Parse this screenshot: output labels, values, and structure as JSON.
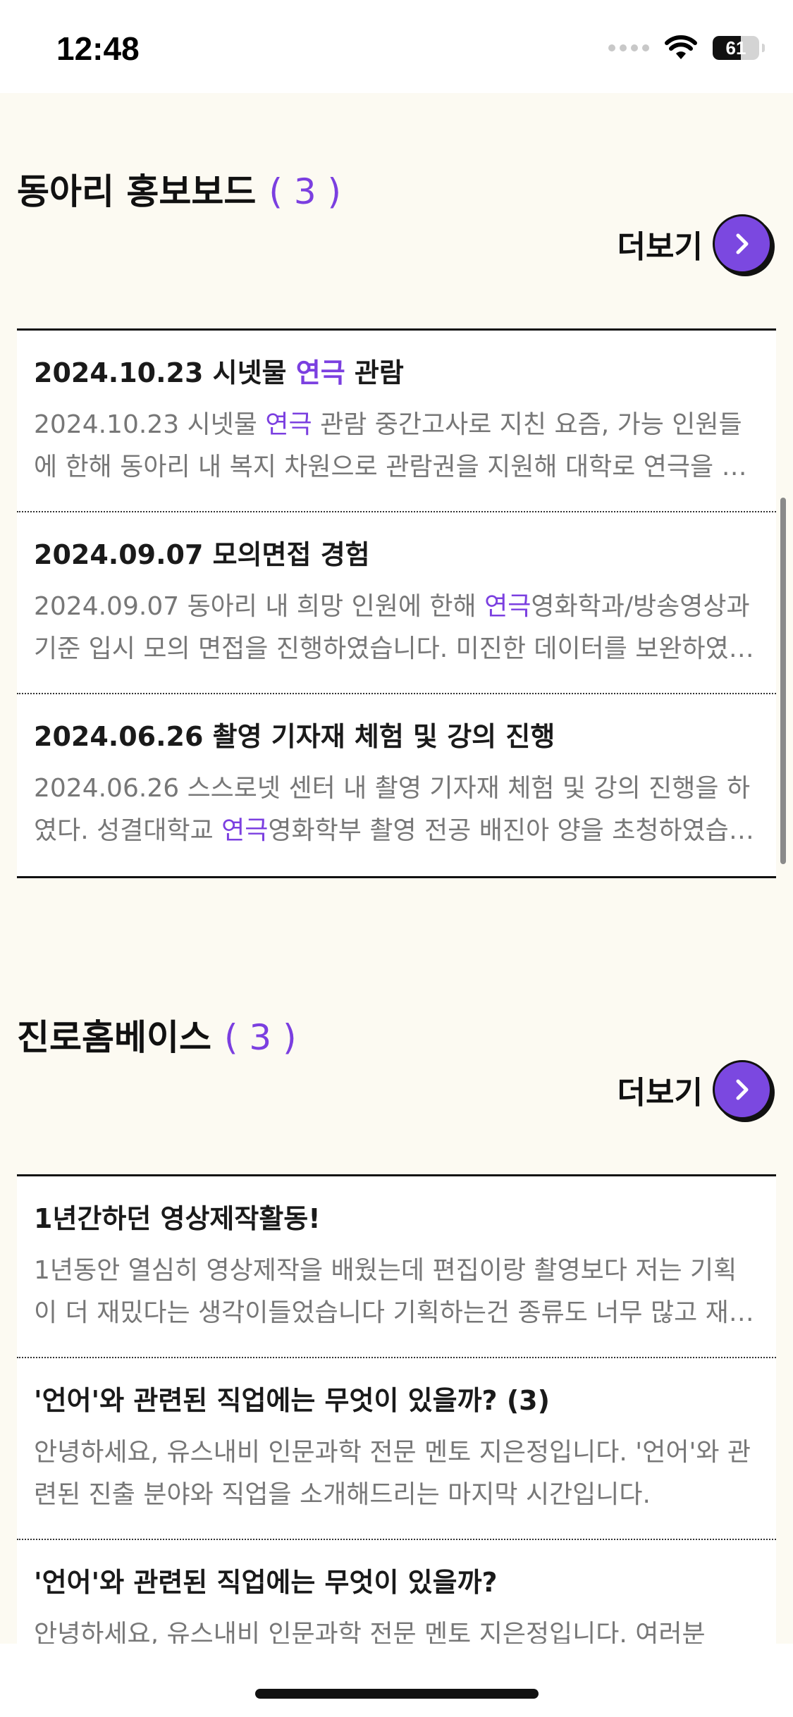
{
  "status_bar": {
    "time": "12:48",
    "battery_level": "61",
    "battery_fraction": 0.61
  },
  "sections": [
    {
      "title": "동아리 홍보보드",
      "count": "( 3 )",
      "more_label": "더보기",
      "cards": [
        {
          "title_parts": [
            "2024.10.23 시넷물 ",
            "연극",
            " 관람"
          ],
          "body_parts": [
            "2024.10.23 시넷물 ",
            "연극",
            " 관람 중간고사로 지친 요즘, 가능 인원들에 한해 동아리 내 복지 차원으로 관람권을 지원해 대학로 연극을 관람하였습니다."
          ]
        },
        {
          "title_parts": [
            "2024.09.07 모의면접 경험",
            "",
            ""
          ],
          "body_parts": [
            "2024.09.07 동아리 내 희망 인원에 한해 ",
            "연극",
            "영화학과/방송영상과 기준 입시 모의 면접을 진행하였습니다. 미진한 데이터를 보완하였습니다."
          ]
        },
        {
          "title_parts": [
            "2024.06.26 촬영 기자재 체험 및 강의 진행",
            "",
            ""
          ],
          "body_parts": [
            "2024.06.26 스스로넷 센터 내 촬영 기자재 체험 및 강의 진행을 하였다. 성결대학교 ",
            "연극",
            "영화학부 촬영 전공 배진아 양을 초청하였습니다."
          ]
        }
      ]
    },
    {
      "title": "진로홈베이스",
      "count": "( 3 )",
      "more_label": "더보기",
      "cards": [
        {
          "title_parts": [
            "1년간하던 영상제작활동!",
            "",
            ""
          ],
          "body_parts": [
            "1년동안 열심히 영상제작을 배웠는데 편집이랑 촬영보다 저는 기획이 더 재밌다는 생각이들었습니다 기획하는건 종류도 너무 많고 재미있습니다.",
            "",
            ""
          ]
        },
        {
          "title_parts": [
            "'언어'와 관련된 직업에는 무엇이 있을까? (3)",
            "",
            ""
          ],
          "body_parts": [
            "안녕하세요, 유스내비 인문과학 전문 멘토 지은정입니다. '언어'와 관련된 진출 분야와 직업을 소개해드리는 마지막 시간입니다.",
            "",
            ""
          ]
        },
        {
          "title_parts": [
            "'언어'와 관련된 직업에는 무엇이 있을까?",
            "",
            ""
          ],
          "body_parts": [
            "안녕하세요, 유스내비 인문과학 전문 멘토 지은정입니다. 여러분",
            "",
            ""
          ]
        }
      ]
    }
  ]
}
